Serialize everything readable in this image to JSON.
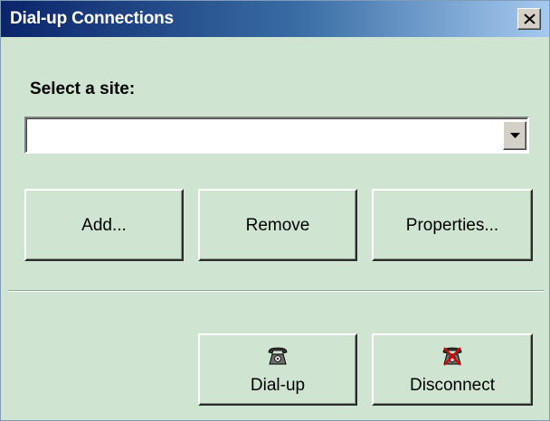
{
  "window": {
    "title": "Dial-up Connections",
    "close_icon": "close-x-icon"
  },
  "site_select": {
    "label": "Select a site:",
    "value": "",
    "dropdown_icon": "chevron-down-icon"
  },
  "actions": {
    "add_label": "Add...",
    "remove_label": "Remove",
    "properties_label": "Properties..."
  },
  "connection": {
    "dialup_label": "Dial-up",
    "dialup_icon": "telephone-icon",
    "disconnect_label": "Disconnect",
    "disconnect_icon": "telephone-crossed-icon"
  },
  "colors": {
    "title_bar_start": "#0a246a",
    "title_bar_end": "#a6caf0",
    "window_background": "#cfe5d2",
    "disconnect_cross": "#e00000"
  }
}
